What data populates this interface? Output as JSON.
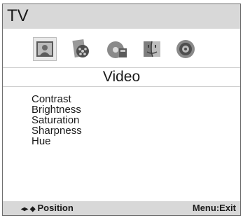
{
  "window": {
    "title": "TV"
  },
  "menu_icons": [
    {
      "name": "picture-icon",
      "selected": true
    },
    {
      "name": "film-reel-icon",
      "selected": false
    },
    {
      "name": "music-disc-icon",
      "selected": false
    },
    {
      "name": "finder-face-icon",
      "selected": false
    },
    {
      "name": "gear-icon",
      "selected": false
    }
  ],
  "section": {
    "title": "Video"
  },
  "settings": {
    "items": [
      {
        "label": "Contrast"
      },
      {
        "label": "Brightness"
      },
      {
        "label": "Saturation"
      },
      {
        "label": "Sharpness"
      },
      {
        "label": "Hue"
      }
    ]
  },
  "footer": {
    "nav_glyph": "◂▸ ◆",
    "position_label": "Position",
    "exit_label": "Menu:Exit"
  }
}
